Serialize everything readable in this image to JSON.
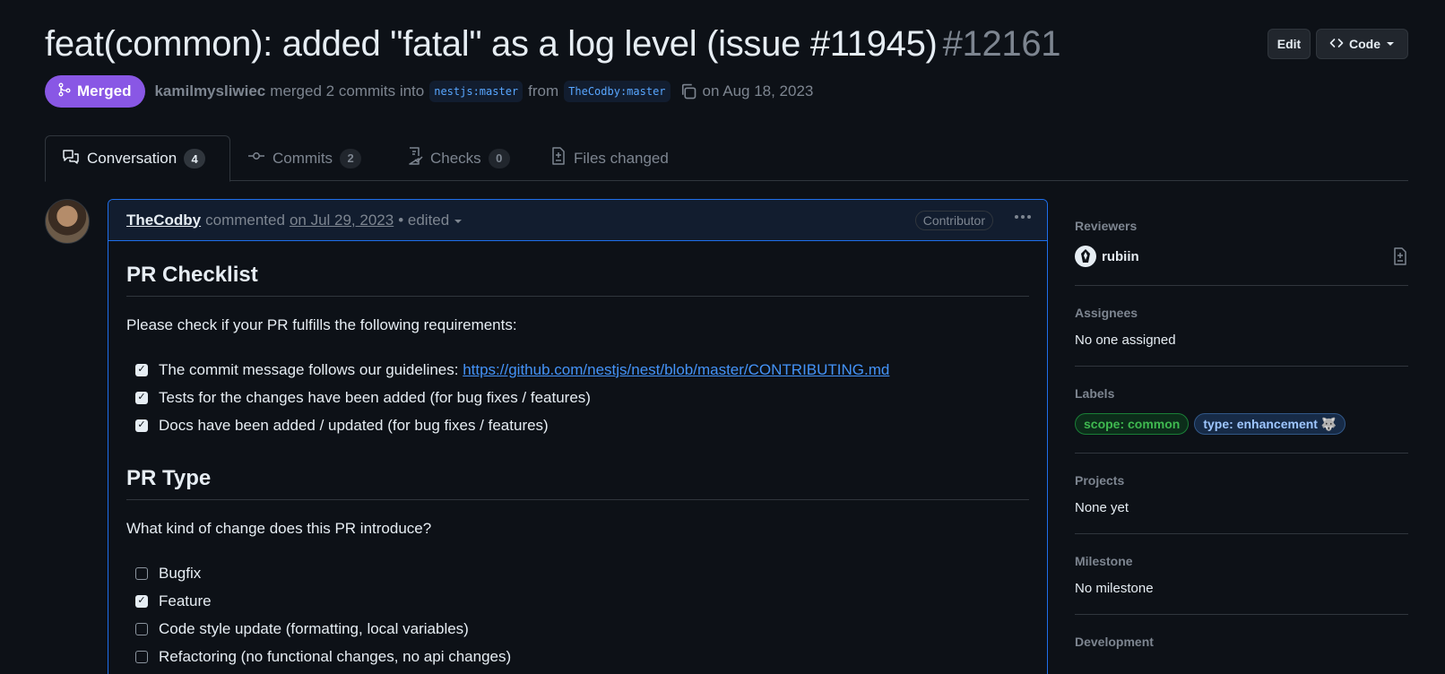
{
  "pr": {
    "title": "feat(common): added \"fatal\" as a log level (issue #11945)",
    "number": "#12161",
    "status": "Merged",
    "author": "kamilmysliwiec",
    "merged_text": "merged 2 commits into",
    "base_branch": "nestjs:master",
    "from_text": "from",
    "head_branch": "TheCodby:master",
    "date_text": "on Aug 18, 2023"
  },
  "header": {
    "edit_label": "Edit",
    "code_label": "Code"
  },
  "tabs": [
    {
      "label": "Conversation",
      "count": "4",
      "icon": "comment-discussion-icon"
    },
    {
      "label": "Commits",
      "count": "2",
      "icon": "commit-icon"
    },
    {
      "label": "Checks",
      "count": "0",
      "icon": "checklist-icon"
    },
    {
      "label": "Files changed",
      "icon": "file-diff-icon"
    }
  ],
  "comment": {
    "author": "TheCodby",
    "action": "commented",
    "date": "on Jul 29, 2023",
    "edited": "• edited",
    "role": "Contributor",
    "heading1": "PR Checklist",
    "intro1": "Please check if your PR fulfills the following requirements:",
    "checklist": [
      {
        "text": "The commit message follows our guidelines: ",
        "link": "https://github.com/nestjs/nest/blob/master/CONTRIBUTING.md",
        "checked": true
      },
      {
        "text": "Tests for the changes have been added (for bug fixes / features)",
        "checked": true
      },
      {
        "text": "Docs have been added / updated (for bug fixes / features)",
        "checked": true
      }
    ],
    "heading2": "PR Type",
    "intro2": "What kind of change does this PR introduce?",
    "types": [
      {
        "text": "Bugfix",
        "checked": false
      },
      {
        "text": "Feature",
        "checked": true
      },
      {
        "text": "Code style update (formatting, local variables)",
        "checked": false
      },
      {
        "text": "Refactoring (no functional changes, no api changes)",
        "checked": false
      }
    ]
  },
  "sidebar": {
    "reviewers_title": "Reviewers",
    "reviewer": "rubiin",
    "assignees_title": "Assignees",
    "assignees_value": "No one assigned",
    "labels_title": "Labels",
    "labels": [
      "scope: common",
      "type: enhancement 🐺"
    ],
    "projects_title": "Projects",
    "projects_value": "None yet",
    "milestone_title": "Milestone",
    "milestone_value": "No milestone",
    "development_title": "Development"
  },
  "colors": {
    "merged": "#8957e5",
    "accent": "#1f6feb",
    "link": "#4493f8",
    "bg": "#0d1117"
  }
}
